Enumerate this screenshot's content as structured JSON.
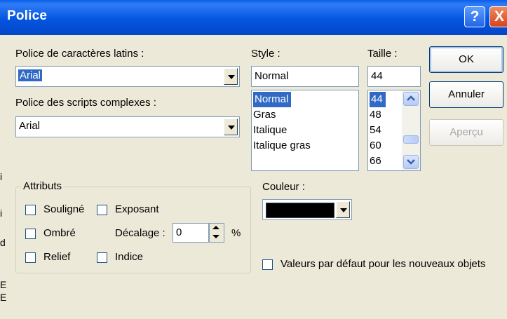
{
  "window": {
    "title": "Police",
    "help_symbol": "?",
    "close_symbol": "X"
  },
  "latin_font": {
    "label": "Police de caractères latins :",
    "value": "Arial"
  },
  "complex_font": {
    "label": "Police des scripts complexes :",
    "value": "Arial"
  },
  "style": {
    "label": "Style :",
    "value": "Normal",
    "options": [
      "Normal",
      "Gras",
      "Italique",
      "Italique gras"
    ],
    "selected_index": 0
  },
  "size": {
    "label": "Taille :",
    "value": "44",
    "options": [
      "44",
      "48",
      "54",
      "60",
      "66"
    ],
    "selected_index": 0
  },
  "buttons": {
    "ok": "OK",
    "cancel": "Annuler",
    "preview": "Aperçu"
  },
  "attributes": {
    "title": "Attributs",
    "underline": "Souligné",
    "shadow": "Ombré",
    "emboss": "Relief",
    "superscript": "Exposant",
    "offset_label": "Décalage :",
    "offset_value": "0",
    "offset_unit": "%",
    "subscript": "Indice"
  },
  "color": {
    "label": "Couleur :",
    "swatch": "#000000"
  },
  "default_checkbox": {
    "label": "Valeurs par défaut pour les nouveaux objets"
  },
  "edge_glyphs": [
    "i",
    "i",
    "d",
    "E",
    "E"
  ],
  "colors": {
    "titlebar": "#0556e0",
    "dialog_bg": "#ece9d8",
    "selection": "#316ac5"
  }
}
